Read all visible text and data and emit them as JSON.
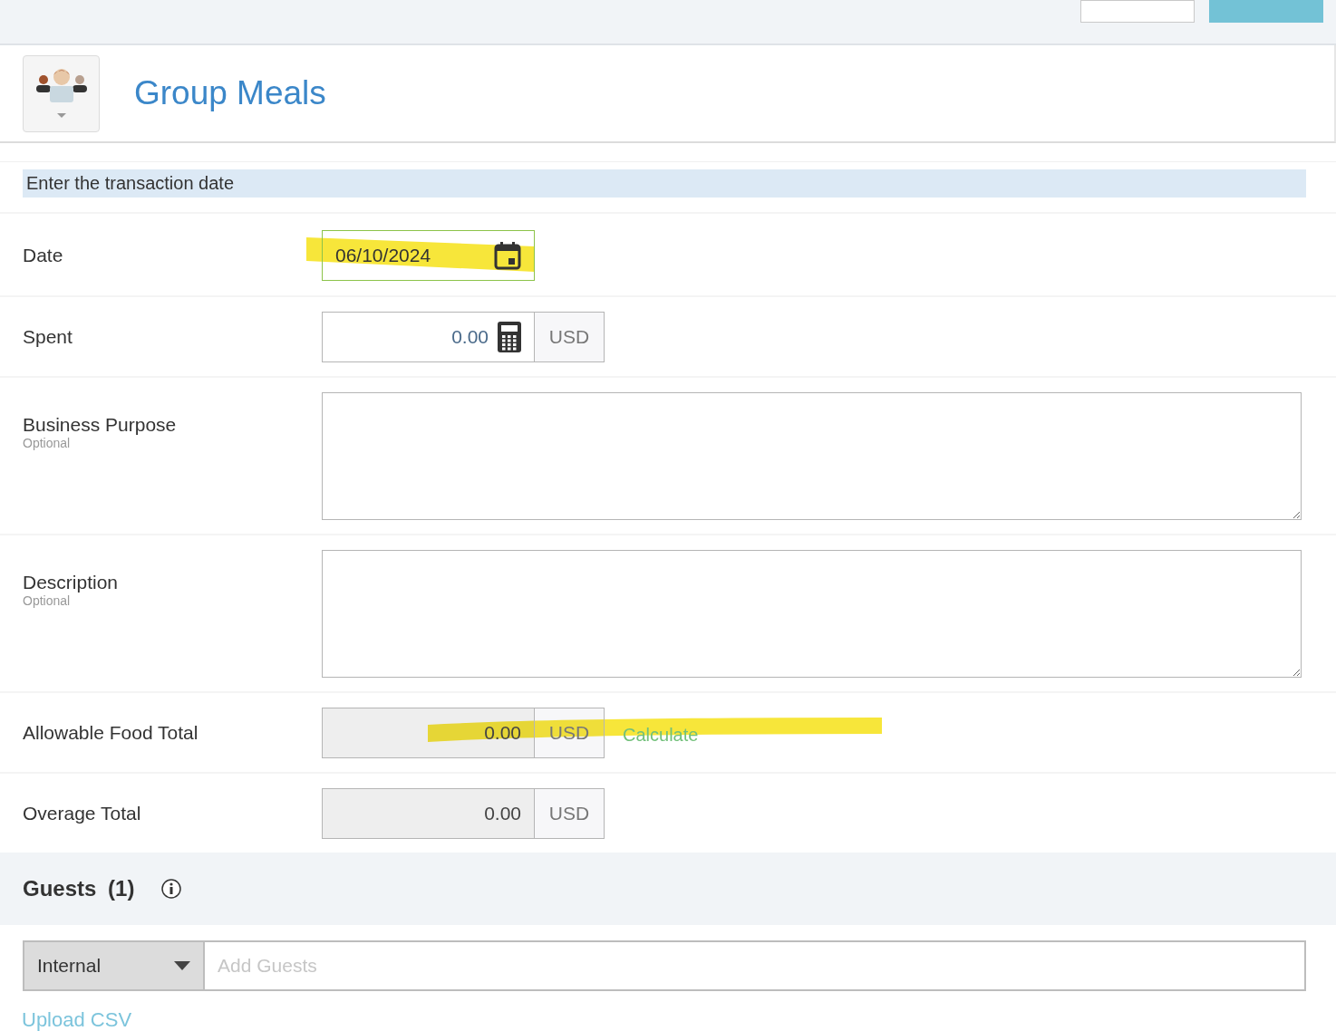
{
  "top_bar": {
    "buttons": [
      {
        "kind": "secondary"
      },
      {
        "kind": "primary"
      }
    ]
  },
  "header": {
    "title": "Group Meals"
  },
  "instruction": "Enter the transaction date",
  "fields": [
    {
      "kind": "date",
      "label": "Date",
      "value": "06/10/2024",
      "focused": true,
      "highlighted": true
    },
    {
      "kind": "amount",
      "label": "Spent",
      "value": "0.00",
      "currency": "USD"
    },
    {
      "kind": "textarea",
      "label": "Business Purpose",
      "hint": "Optional"
    },
    {
      "kind": "textarea",
      "label": "Description",
      "hint": "Optional"
    },
    {
      "kind": "readonly",
      "label": "Allowable Food Total",
      "value": "0.00",
      "currency": "USD",
      "action": "Calculate",
      "highlighted": true
    },
    {
      "kind": "readonly",
      "label": "Overage Total",
      "value": "0.00",
      "currency": "USD"
    }
  ],
  "guests": {
    "title": "Guests",
    "count": "(1)",
    "type": "Internal",
    "placeholder": "Add Guests",
    "upload_link": "Upload CSV"
  }
}
